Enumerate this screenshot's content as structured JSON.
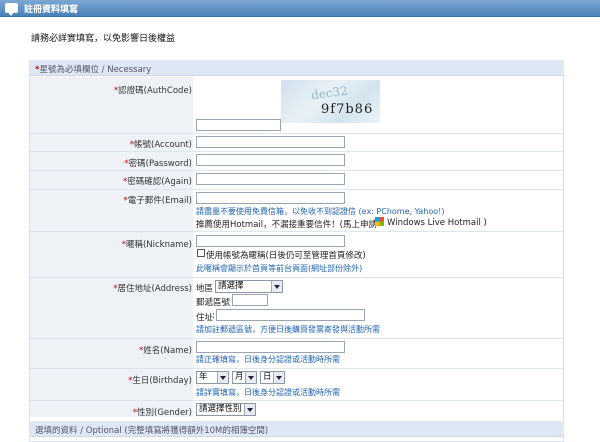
{
  "header": {
    "title": "註冊資料填寫"
  },
  "notice": "請務必詳實填寫，以免影響日後權益",
  "required_section": {
    "marker": "*",
    "text": "星號為必填欄位 / Necessary"
  },
  "fields": {
    "authcode": {
      "label": "認證碼(AuthCode)",
      "captcha_text": "9f7b86",
      "captcha_bg_text": "dec32"
    },
    "account": {
      "label": "帳號(Account)"
    },
    "password": {
      "label": "密碼(Password)"
    },
    "again": {
      "label": "密碼確認(Again)"
    },
    "email": {
      "label": "電子郵件(Email)",
      "hint": "請盡量不要使用免費信箱，以免收不到認證信 (ex: PChome, Yahoo!)",
      "hotmail_text": "推薦使用Hotmail，不漏接重要信件！(馬上申請",
      "windows_live": "Windows Live",
      "hotmail_brand": "Hotmail )"
    },
    "nickname": {
      "label": "暱稱(Nickname)",
      "checkbox_label": "使用帳號為暱稱(日後仍可至管理首頁修改)",
      "hint": "此暱稱會顯示於首頁等前台頁面(網址部份除外)"
    },
    "address": {
      "label": "居住地址(Address)",
      "area_label": "地區",
      "area_value": "請選擇",
      "zip_label": "郵遞區號",
      "addr_label": "住址",
      "hint": "請加註郵遞區號，方便日後購買發票寄發與活動所需"
    },
    "name": {
      "label": "姓名(Name)",
      "hint": "請正確填寫，日後身分認證或活動時所需"
    },
    "birthday": {
      "label": "生日(Birthday)",
      "year": "年",
      "month": "月",
      "day": "日",
      "hint": "請詳實填寫，日後身分認證或活動時所需"
    },
    "gender": {
      "label": "性別(Gender)",
      "value": "請選擇性別"
    }
  },
  "optional_section": {
    "text": "選填的資料 / Optional (完整填寫將獲得額外10M的相簿空間)"
  }
}
